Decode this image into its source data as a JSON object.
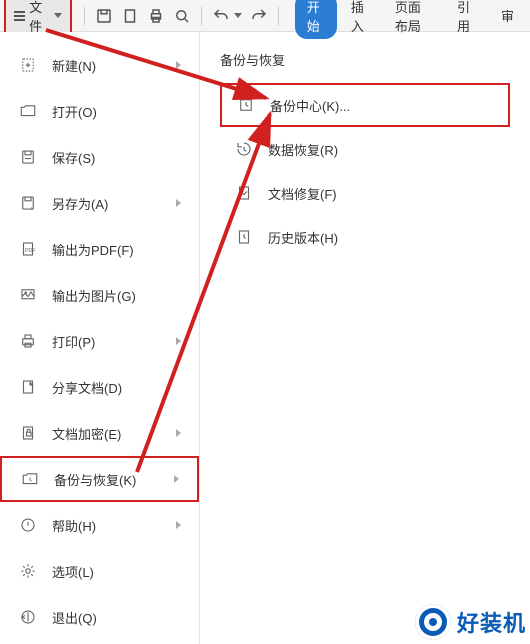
{
  "toolbar": {
    "file_label": "文件",
    "tabs": [
      "开始",
      "插入",
      "页面布局",
      "引用",
      "审"
    ]
  },
  "sidebar": {
    "items": [
      {
        "label": "新建(N)",
        "arrow": true
      },
      {
        "label": "打开(O)"
      },
      {
        "label": "保存(S)"
      },
      {
        "label": "另存为(A)",
        "arrow": true
      },
      {
        "label": "输出为PDF(F)"
      },
      {
        "label": "输出为图片(G)"
      },
      {
        "label": "打印(P)",
        "arrow": true
      },
      {
        "label": "分享文档(D)"
      },
      {
        "label": "文档加密(E)",
        "arrow": true
      },
      {
        "label": "备份与恢复(K)",
        "arrow": true,
        "highlighted": true
      },
      {
        "label": "帮助(H)",
        "arrow": true
      },
      {
        "label": "选项(L)"
      },
      {
        "label": "退出(Q)"
      }
    ]
  },
  "panel": {
    "title": "备份与恢复",
    "items": [
      {
        "label": "备份中心(K)...",
        "highlighted": true
      },
      {
        "label": "数据恢复(R)"
      },
      {
        "label": "文档修复(F)"
      },
      {
        "label": "历史版本(H)"
      }
    ]
  },
  "watermark": {
    "text": "好装机"
  }
}
